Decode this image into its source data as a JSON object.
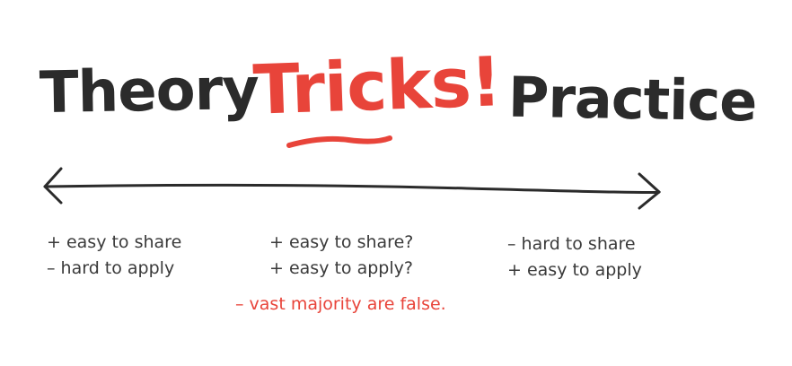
{
  "headings": {
    "theory": "Theory",
    "tricks": "Tricks!",
    "practice": "Practice"
  },
  "columns": {
    "theory": {
      "line1": "+ easy to share",
      "line2": "– hard to apply"
    },
    "tricks": {
      "line1": "+ easy to share?",
      "line2": "+ easy to apply?",
      "warning": "– vast majority are false."
    },
    "practice": {
      "line1": "– hard to share",
      "line2": "+ easy to apply"
    }
  },
  "colors": {
    "ink": "#2b2b2b",
    "accent": "#e8443a",
    "text": "#3a3a3a"
  }
}
